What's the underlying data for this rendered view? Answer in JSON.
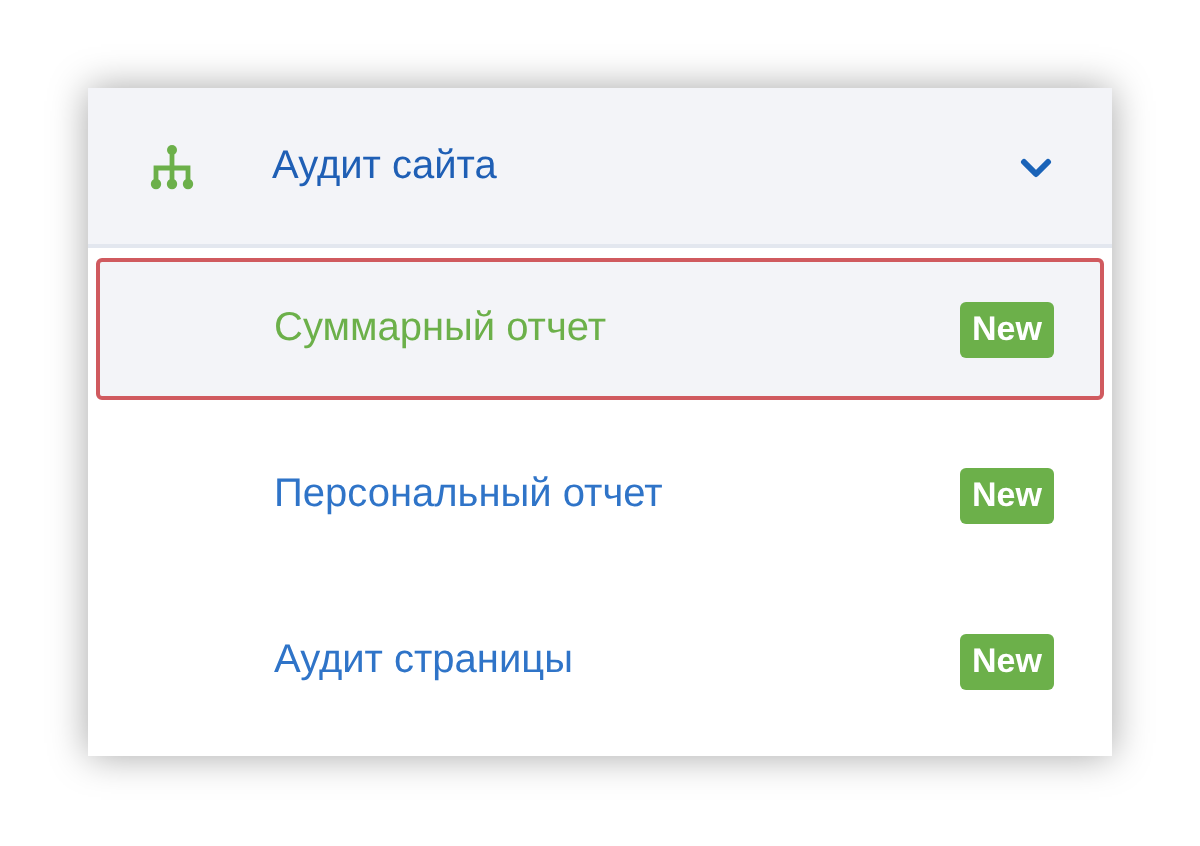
{
  "menu": {
    "title": "Аудит сайта",
    "expanded": true,
    "items": [
      {
        "label": "Суммарный отчет",
        "badge": "New",
        "selected": true
      },
      {
        "label": "Персональный отчет",
        "badge": "New",
        "selected": false
      },
      {
        "label": "Аудит страницы",
        "badge": "New",
        "selected": false
      }
    ]
  }
}
